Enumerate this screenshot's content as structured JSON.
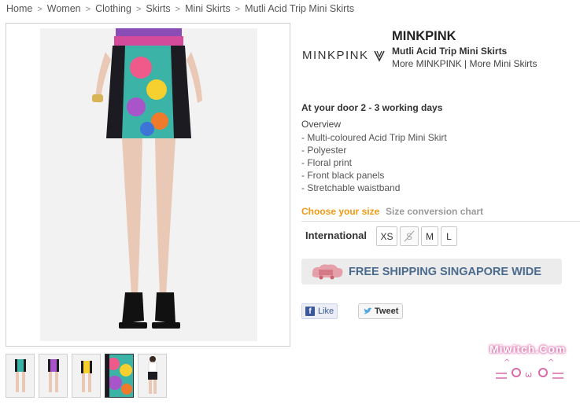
{
  "breadcrumb": [
    "Home",
    "Women",
    "Clothing",
    "Skirts",
    "Mini Skirts",
    "Mutli Acid Trip Mini Skirts"
  ],
  "brand": {
    "logo_text": "MINKPINK",
    "name": "MINKPINK",
    "product_name": "Mutli Acid Trip Mini Skirts",
    "more_brand": "More MINKPINK",
    "more_separator": "|",
    "more_category": "More Mini Skirts"
  },
  "delivery": "At your door 2 - 3 working days",
  "overview": {
    "title": "Overview",
    "items": [
      "- Multi-coloured Acid Trip Mini Skirt",
      "- Polyester",
      "- Floral print",
      "- Front black panels",
      "- Stretchable waistband"
    ]
  },
  "size": {
    "choose_label": "Choose your size",
    "chart_link": "Size conversion chart",
    "system_label": "International",
    "options": [
      {
        "label": "XS",
        "available": true
      },
      {
        "label": "S",
        "available": false
      },
      {
        "label": "M",
        "available": true
      },
      {
        "label": "L",
        "available": true
      }
    ]
  },
  "shipping_banner": "FREE SHIPPING SINGAPORE WIDE",
  "social": {
    "like_label": "Like",
    "tweet_label": "Tweet"
  },
  "watermark": "Miwitch.Com",
  "icons": {
    "facebook": "facebook-icon",
    "twitter": "twitter-bird-icon",
    "truck": "delivery-truck-icon",
    "breadcrumb_separator": "chevron-right-icon"
  },
  "colors": {
    "accent_orange": "#f09a12",
    "shipping_text": "#4a6b8d",
    "facebook_blue": "#3b5998",
    "watermark_pink": "#d96aa8"
  }
}
